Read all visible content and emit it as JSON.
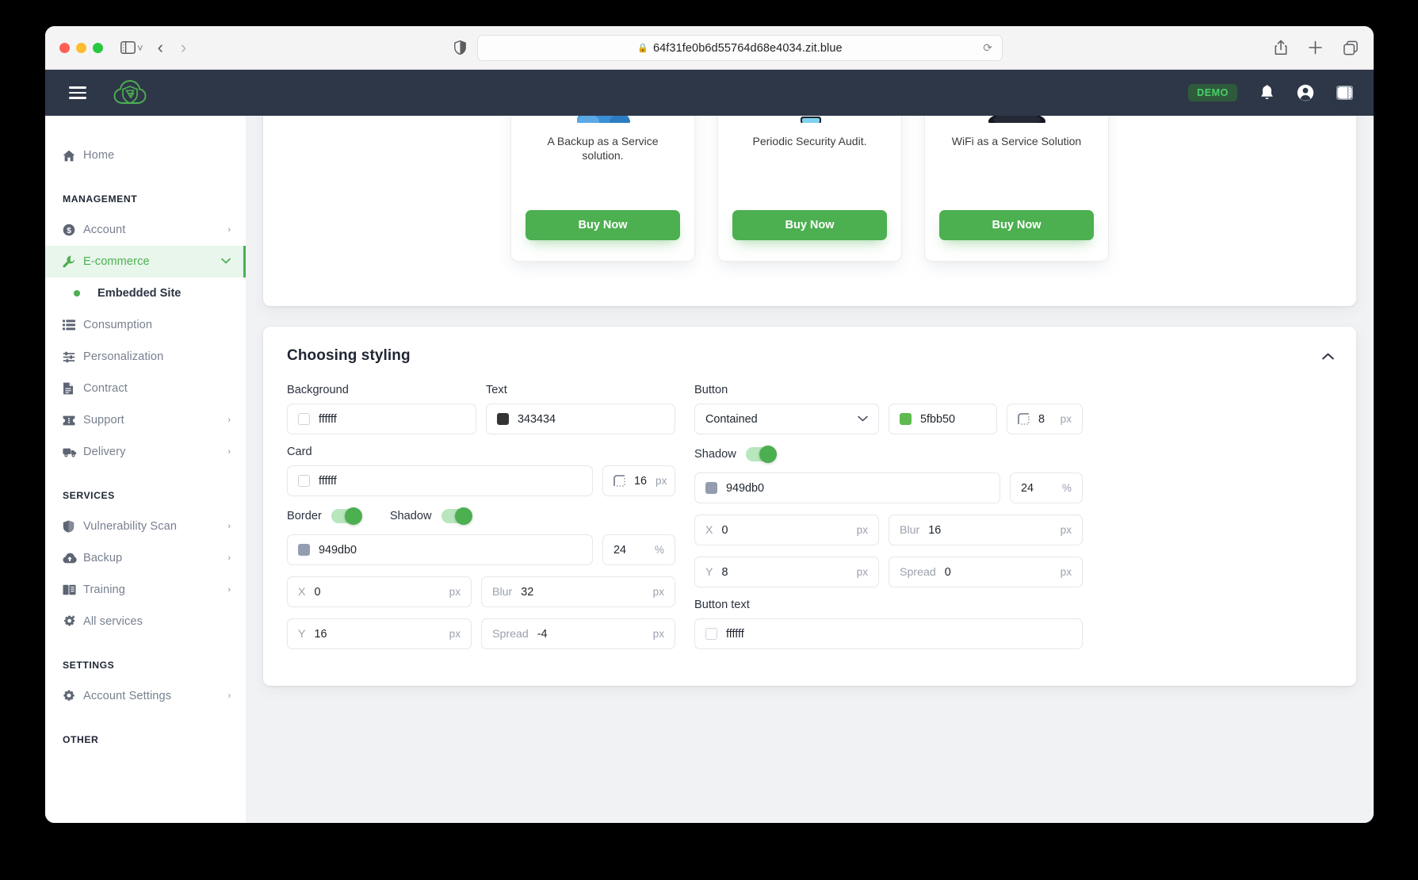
{
  "browser": {
    "url": "64f31fe0b6d55764d68e4034.zit.blue",
    "lock_icon": "lock-icon",
    "reload_icon": "reload-icon",
    "share_icon": "share-icon",
    "newtab_icon": "plus-icon",
    "tabs_icon": "tab-overview-icon",
    "shield_icon": "privacy-shield-icon",
    "sidebar_icon": "sidebar-toggle-icon",
    "back_icon": "back-chevron-icon",
    "forward_icon": "forward-chevron-icon"
  },
  "header": {
    "menu_icon": "hamburger-icon",
    "logo_icon": "cloud-shield-logo",
    "demo_badge": "DEMO",
    "bell_icon": "notification-bell-icon",
    "account_icon": "user-account-icon",
    "panel_icon": "right-panel-icon"
  },
  "sidebar": {
    "home": {
      "label": "Home",
      "icon": "home-icon"
    },
    "sections": [
      {
        "title": "MANAGEMENT",
        "items": [
          {
            "label": "Account",
            "icon": "dollar-circle-icon",
            "chevron": "›",
            "active": false
          },
          {
            "label": "E-commerce",
            "icon": "wrench-icon",
            "chevron": "⌄",
            "active": true
          },
          {
            "label": "Consumption",
            "icon": "list-icon",
            "chevron": "",
            "active": false
          },
          {
            "label": "Personalization",
            "icon": "sliders-icon",
            "chevron": "",
            "active": false
          },
          {
            "label": "Contract",
            "icon": "document-icon",
            "chevron": "",
            "active": false
          },
          {
            "label": "Support",
            "icon": "ticket-icon",
            "chevron": "›",
            "active": false
          },
          {
            "label": "Delivery",
            "icon": "truck-icon",
            "chevron": "›",
            "active": false
          }
        ]
      },
      {
        "title": "SERVICES",
        "items": [
          {
            "label": "Vulnerability Scan",
            "icon": "shield-icon",
            "chevron": "›",
            "active": false
          },
          {
            "label": "Backup",
            "icon": "cloud-upload-icon",
            "chevron": "›",
            "active": false
          },
          {
            "label": "Training",
            "icon": "book-icon",
            "chevron": "›",
            "active": false
          },
          {
            "label": "All services",
            "icon": "gear-plus-icon",
            "chevron": "",
            "active": false
          }
        ]
      },
      {
        "title": "SETTINGS",
        "items": [
          {
            "label": "Account Settings",
            "icon": "gear-icon",
            "chevron": "›",
            "active": false
          }
        ]
      },
      {
        "title": "OTHER",
        "items": []
      }
    ],
    "submenu": {
      "label": "Embedded Site"
    }
  },
  "preview": {
    "products": [
      {
        "description": "A Backup as a Service solution.",
        "button": "Buy Now",
        "image": "backup-cloud-image"
      },
      {
        "description": "Periodic Security Audit.",
        "button": "Buy Now",
        "image": "security-audit-image"
      },
      {
        "description": "WiFi as a Service Solution",
        "button": "Buy Now",
        "image": "wifi-device-image"
      }
    ]
  },
  "styling": {
    "title": "Choosing styling",
    "collapse_icon": "chevron-up-icon",
    "background": {
      "label": "Background",
      "color": "ffffff",
      "swatch": "white"
    },
    "text": {
      "label": "Text",
      "color": "343434",
      "swatch": "dark"
    },
    "button": {
      "label": "Button",
      "variant": "Contained",
      "variant_options": [
        "Contained"
      ],
      "color": "5fbb50",
      "swatch": "green",
      "radius": "8",
      "radius_unit": "px",
      "shadow_label": "Shadow",
      "shadow_on": true,
      "shadow_color": "949db0",
      "shadow_opacity": "24",
      "shadow_opacity_unit": "%",
      "x_label": "X",
      "x": "0",
      "x_unit": "px",
      "blur_label": "Blur",
      "blur": "16",
      "blur_unit": "px",
      "y_label": "Y",
      "y": "8",
      "y_unit": "px",
      "spread_label": "Spread",
      "spread": "0",
      "spread_unit": "px"
    },
    "button_text": {
      "label": "Button text",
      "color": "ffffff",
      "swatch": "white"
    },
    "card": {
      "label": "Card",
      "color": "ffffff",
      "swatch": "white",
      "radius": "16",
      "radius_unit": "px",
      "border_label": "Border",
      "border_on": true,
      "shadow_label": "Shadow",
      "shadow_on": true,
      "shadow_color": "949db0",
      "shadow_opacity": "24",
      "shadow_opacity_unit": "%",
      "x_label": "X",
      "x": "0",
      "x_unit": "px",
      "blur_label": "Blur",
      "blur": "32",
      "blur_unit": "px",
      "y_label": "Y",
      "y": "16",
      "y_unit": "px",
      "spread_label": "Spread",
      "spread": "-4",
      "spread_unit": "px"
    }
  },
  "colors": {
    "accent_green": "#4caf50",
    "header_dark": "#2e3748",
    "page_bg": "#f1f2f4"
  }
}
